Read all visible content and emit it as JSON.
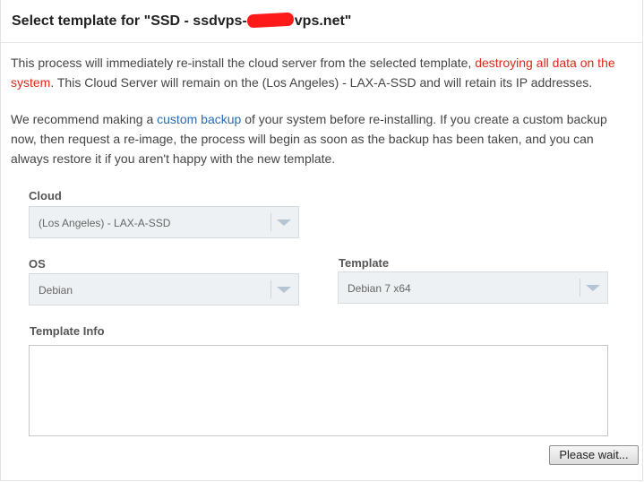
{
  "dialog": {
    "title_prefix": "Select template for \"SSD - ssdvps-",
    "title_suffix": "vps.net\""
  },
  "paragraph1": {
    "text_before": "This process will immediately re-install the cloud server from the selected template, ",
    "danger_text": "destroying all data on the system",
    "text_after": ". This Cloud Server will remain on the (Los Angeles) - LAX-A-SSD and will retain its IP addresses."
  },
  "paragraph2": {
    "text_before": "We recommend making a ",
    "link_text": "custom backup",
    "text_after": " of your system before re-installing. If you create a custom backup now, then request a re-image, the process will begin as soon as the backup has been taken, and you can always restore it if you aren't happy with the new template."
  },
  "form": {
    "cloud": {
      "label": "Cloud",
      "value": "(Los Angeles) - LAX-A-SSD"
    },
    "os": {
      "label": "OS",
      "value": "Debian"
    },
    "template": {
      "label": "Template",
      "value": "Debian 7 x64"
    },
    "template_info": {
      "label": "Template Info",
      "value": ""
    }
  },
  "actions": {
    "submit_label": "Please wait..."
  },
  "colors": {
    "danger": "#e0271c",
    "link": "#2b6bb3",
    "disabled_bg": "#eef1f4"
  },
  "icons": {
    "dropdown": "chevron-down-icon"
  }
}
